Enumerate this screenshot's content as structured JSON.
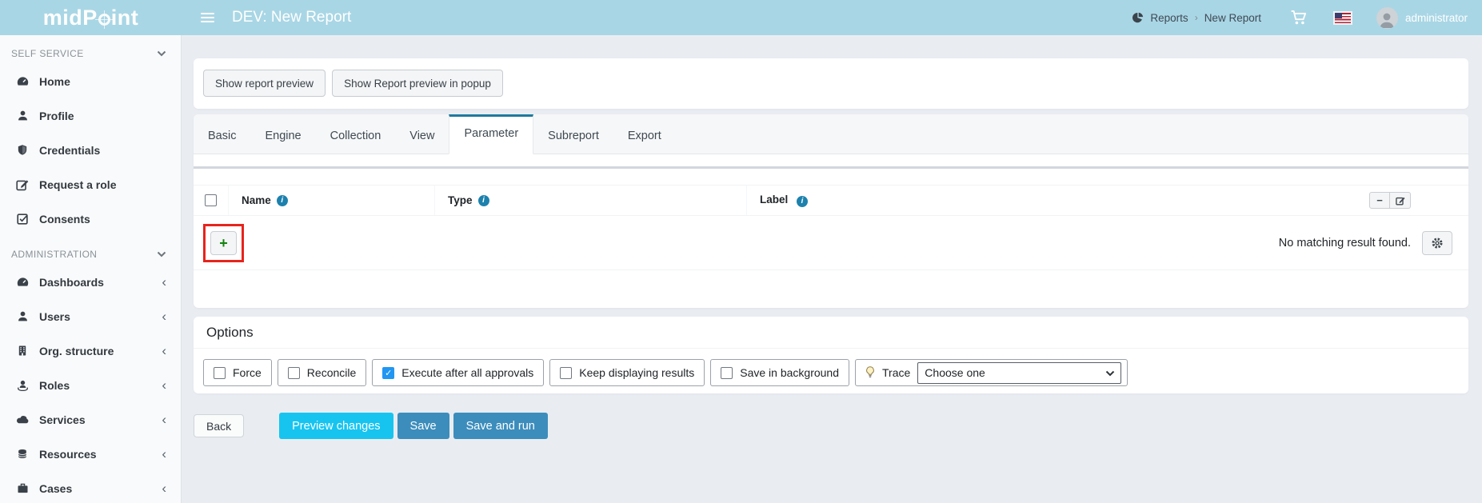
{
  "header": {
    "logo_prefix": "midP",
    "logo_suffix": "int",
    "title": "DEV: New Report",
    "breadcrumb": {
      "reports": "Reports",
      "current": "New Report"
    },
    "username": "administrator"
  },
  "sidebar": {
    "sections": [
      {
        "label": "SELF SERVICE",
        "items": [
          {
            "label": "Home",
            "icon": "dashboard-gauge-icon"
          },
          {
            "label": "Profile",
            "icon": "user-icon"
          },
          {
            "label": "Credentials",
            "icon": "shield-icon"
          },
          {
            "label": "Request a role",
            "icon": "edit-pen-icon"
          },
          {
            "label": "Consents",
            "icon": "check-square-icon"
          }
        ]
      },
      {
        "label": "ADMINISTRATION",
        "items": [
          {
            "label": "Dashboards",
            "icon": "dashboard-gauge-icon"
          },
          {
            "label": "Users",
            "icon": "user-icon",
            "color": "#dd4b39"
          },
          {
            "label": "Org. structure",
            "icon": "building-icon",
            "color": "#f0a30a"
          },
          {
            "label": "Roles",
            "icon": "role-user-icon",
            "color": "#00a65a"
          },
          {
            "label": "Services",
            "icon": "cloud-icon",
            "color": "#29b6e4"
          },
          {
            "label": "Resources",
            "icon": "database-icon",
            "color": "#5c55a6"
          },
          {
            "label": "Cases",
            "icon": "briefcase-icon"
          }
        ]
      }
    ]
  },
  "toolbar": {
    "show_preview": "Show report preview",
    "show_preview_popup": "Show Report preview in popup"
  },
  "tabs": {
    "items": [
      "Basic",
      "Engine",
      "Collection",
      "View",
      "Parameter",
      "Subreport",
      "Export"
    ],
    "active": "Parameter"
  },
  "table": {
    "columns": {
      "name": "Name",
      "type": "Type",
      "label": "Label"
    },
    "info_glyph": "i",
    "minus_glyph": "−",
    "plus_glyph": "+",
    "empty_message": "No matching result found."
  },
  "options": {
    "title": "Options",
    "checkboxes": [
      {
        "label": "Force",
        "checked": false
      },
      {
        "label": "Reconcile",
        "checked": false
      },
      {
        "label": "Execute after all approvals",
        "checked": true
      },
      {
        "label": "Keep displaying results",
        "checked": false
      },
      {
        "label": "Save in background",
        "checked": false
      }
    ],
    "check_glyph": "✓",
    "trace": {
      "label": "Trace",
      "selected": "Choose one"
    }
  },
  "actions": {
    "back": "Back",
    "preview_changes": "Preview changes",
    "save": "Save",
    "save_and_run": "Save and run"
  },
  "colors": {
    "header_bg": "#a9d6e5",
    "active_tab_accent": "#1f7a9e",
    "primary_button": "#3c8dbc",
    "info_button": "#17c4f0",
    "checkbox_checked": "#2196f3",
    "users_icon": "#dd4b39",
    "org_icon": "#f0a30a",
    "roles_icon": "#00a65a",
    "services_icon": "#29b6e4",
    "resources_icon": "#5c55a6",
    "plus_icon": "#12830f",
    "annotation_highlight": "#e6241c"
  }
}
